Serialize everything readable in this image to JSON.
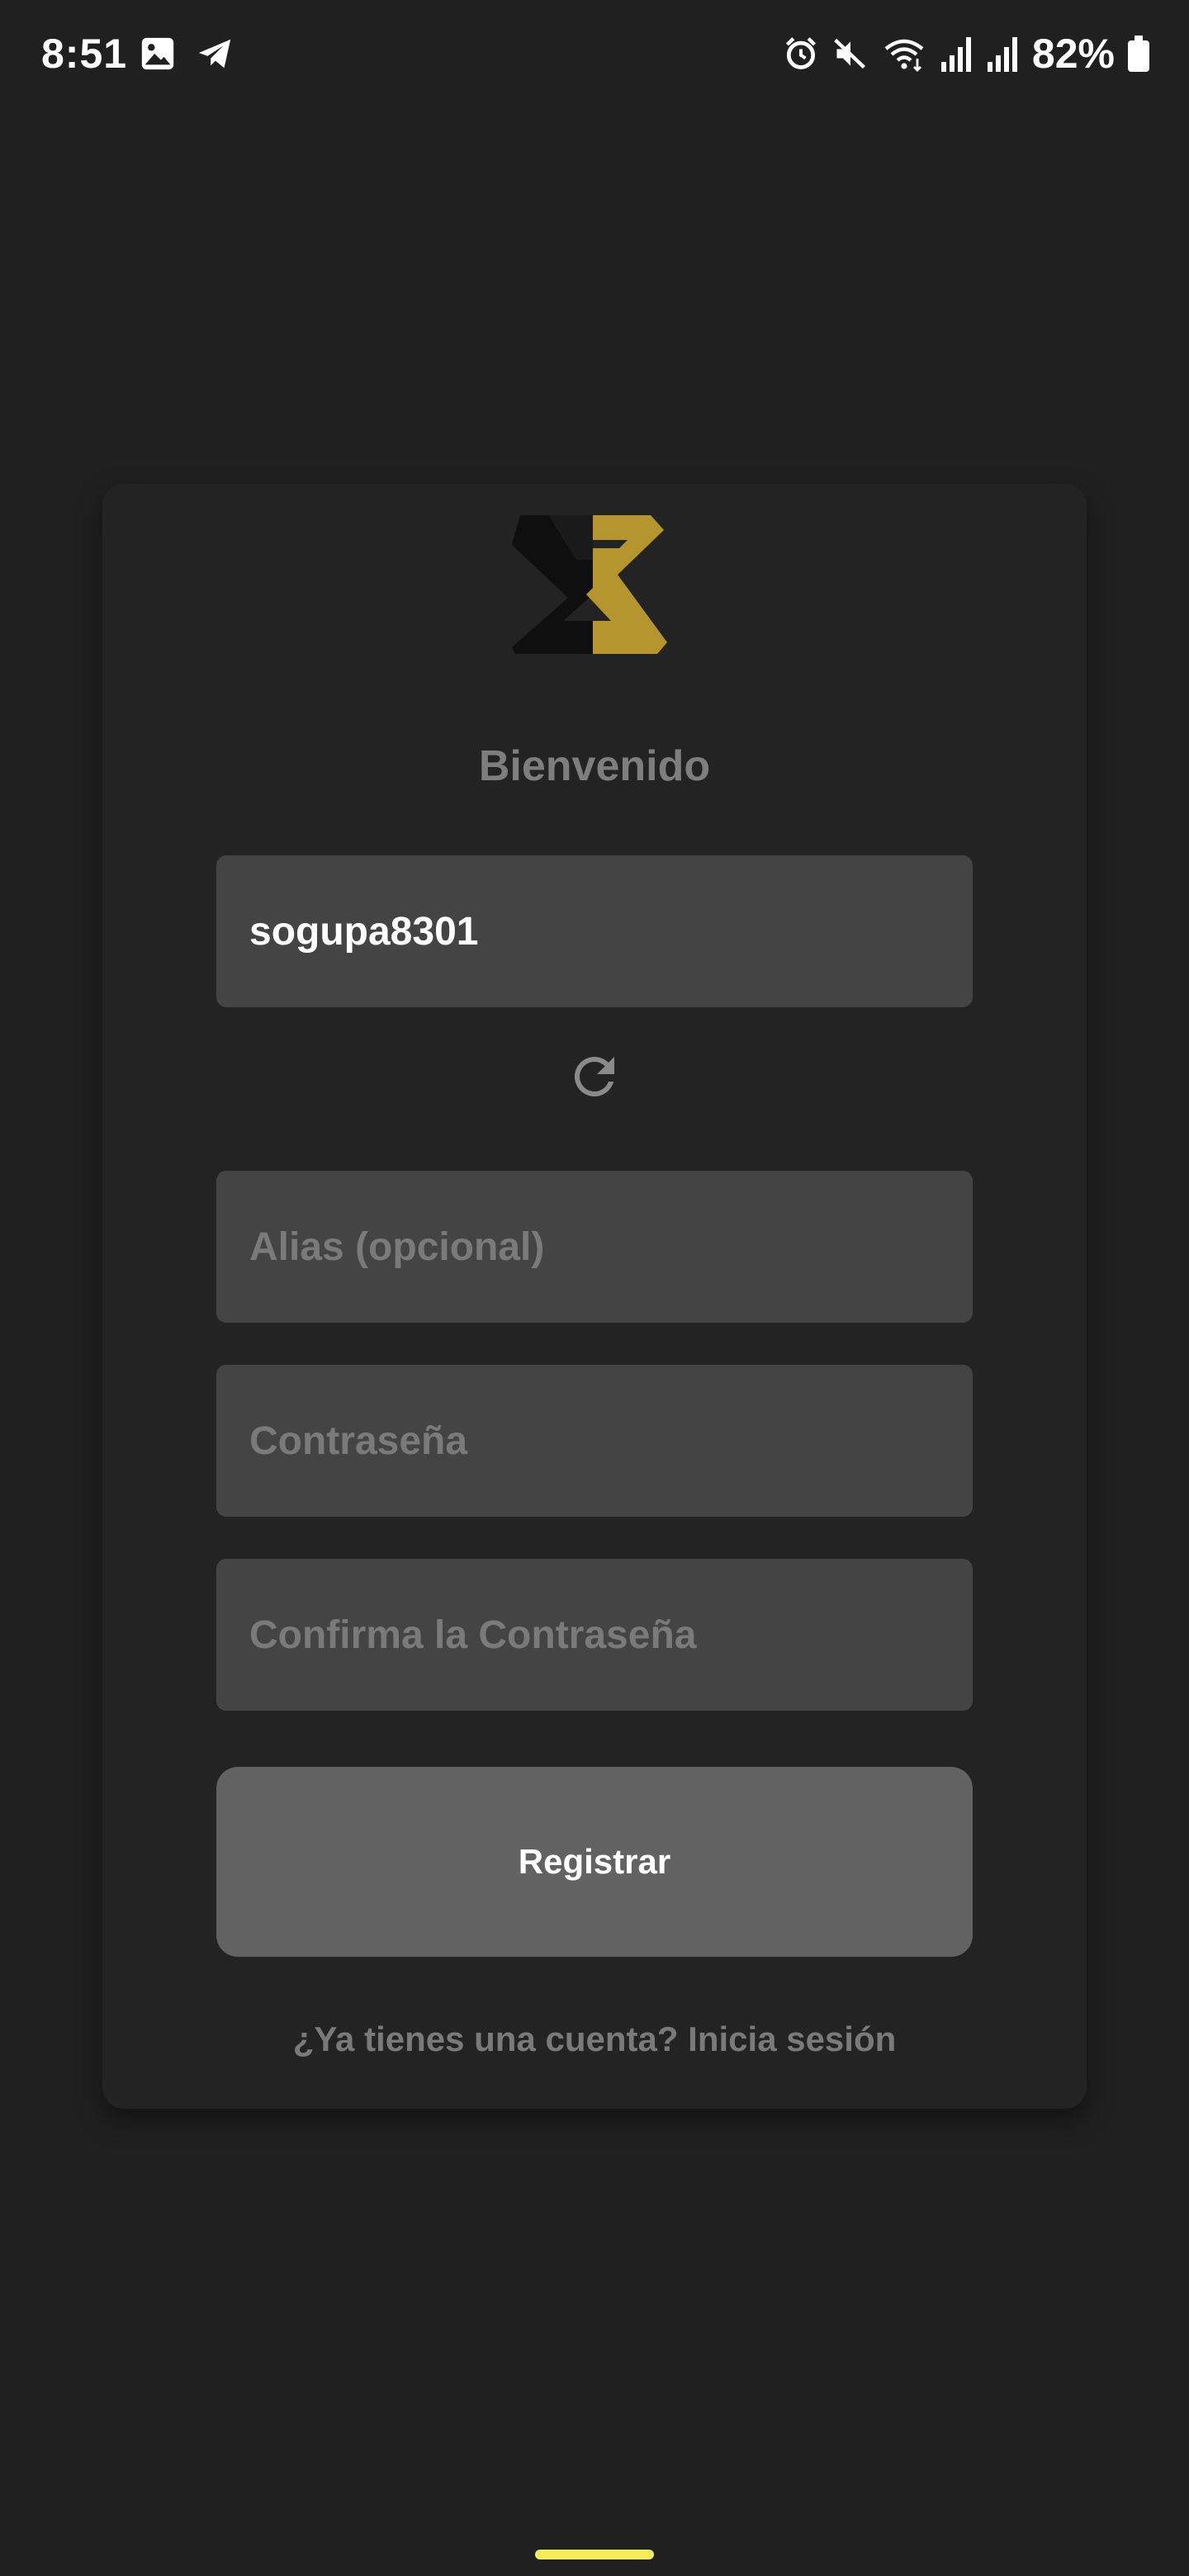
{
  "status_bar": {
    "time": "8:51",
    "battery_percent": "82%",
    "left_icons": [
      "gallery-icon",
      "telegram-icon"
    ],
    "right_icons": [
      "alarm-icon",
      "mute-icon",
      "wifi-icon",
      "signal-icon",
      "signal-icon",
      "battery-icon"
    ]
  },
  "logo": {
    "colors": {
      "dark": "#0f0f0f",
      "gold": "#b5962e"
    }
  },
  "form": {
    "title": "Bienvenido",
    "username_value": "sogupa8301",
    "alias_placeholder": "Alias (opcional)",
    "password_placeholder": "Contraseña",
    "confirm_placeholder": "Confirma la Contraseña",
    "register_label": "Registrar",
    "login_link": "¿Ya tienes una cuenta? Inicia sesión"
  },
  "colors": {
    "background": "#202020",
    "card": "#232323",
    "field": "#444444",
    "button": "#626262",
    "muted_text": "#7a7a7a",
    "home_indicator": "#f4ec58"
  }
}
